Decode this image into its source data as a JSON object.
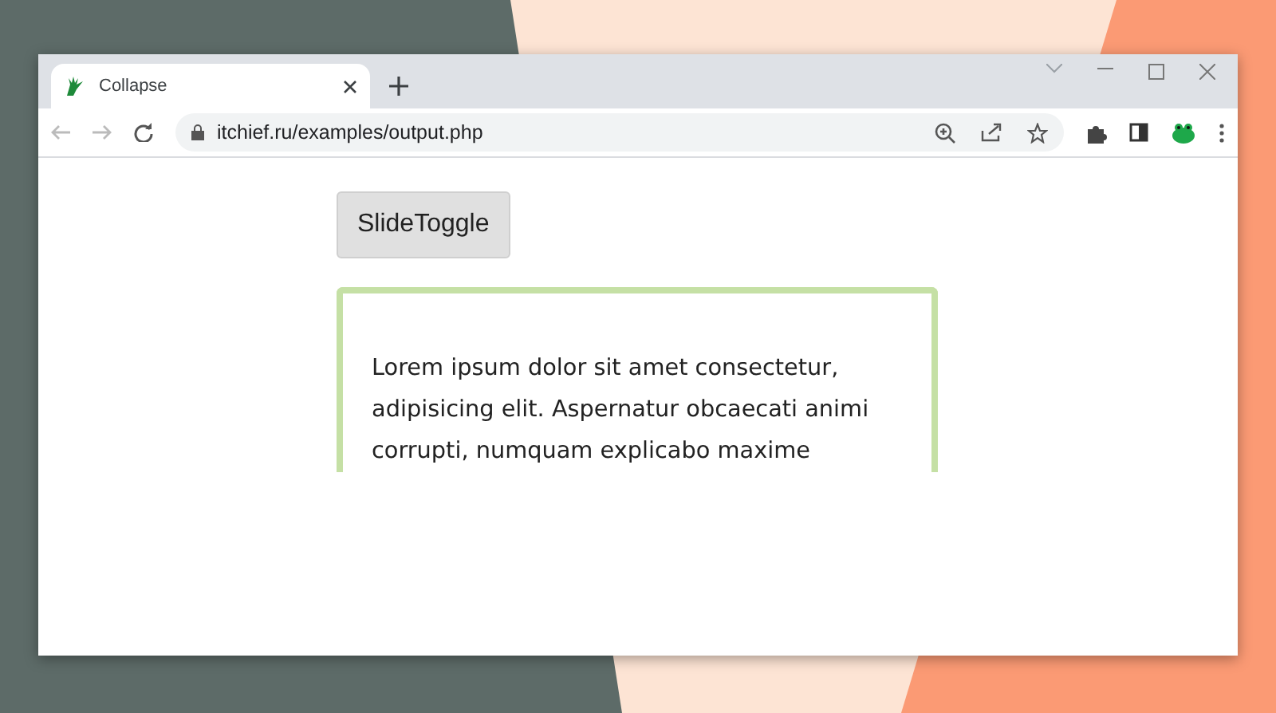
{
  "tab": {
    "title": "Collapse",
    "selected": true
  },
  "address_bar": {
    "url": "itchief.ru/examples/output.php"
  },
  "page": {
    "button": "SlideToggle",
    "panel_lines": [
      "Lorem ipsum dolor sit amet consectetur,",
      "adipisicing elit. Aspernatur obcaecati animi",
      "corrupti, numquam explicabo maxime"
    ]
  }
}
